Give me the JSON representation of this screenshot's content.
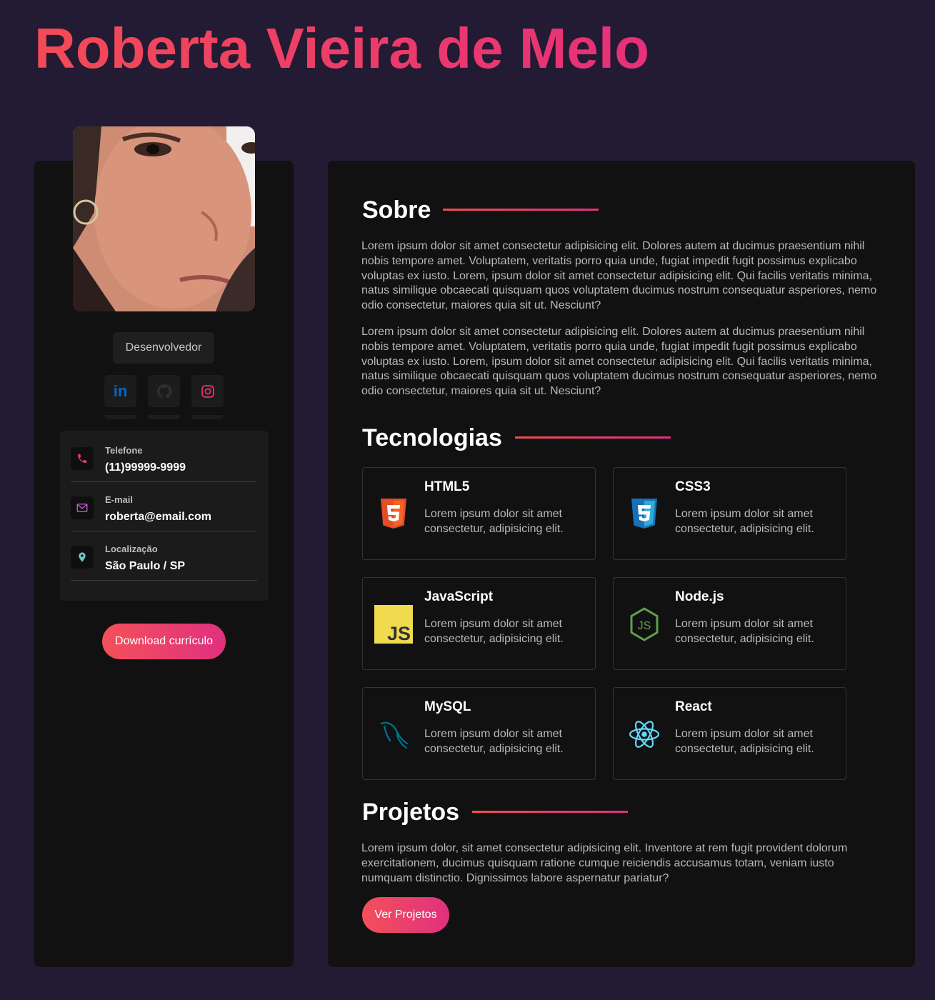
{
  "header": {
    "name": "Roberta Vieira de Melo"
  },
  "sidebar": {
    "role": "Desenvolvedor",
    "social": [
      {
        "icon": "linkedin-icon",
        "color": "#0a66c2"
      },
      {
        "icon": "github-icon",
        "color": "#2f2f2f"
      },
      {
        "icon": "instagram-icon",
        "color": "#e1306c"
      }
    ],
    "contacts": [
      {
        "label": "Telefone",
        "value": "(11)99999-9999",
        "icon": "phone-icon"
      },
      {
        "label": "E-mail",
        "value": "roberta@email.com",
        "icon": "mail-icon"
      },
      {
        "label": "Localização",
        "value": "São Paulo / SP",
        "icon": "location-icon"
      }
    ],
    "download_label": "Download currículo"
  },
  "about": {
    "title": "Sobre",
    "paragraphs": [
      "Lorem ipsum dolor sit amet consectetur adipisicing elit. Dolores autem at ducimus praesentium nihil nobis tempore amet. Voluptatem, veritatis porro quia unde, fugiat impedit fugit possimus explicabo voluptas ex iusto. Lorem, ipsum dolor sit amet consectetur adipisicing elit. Qui facilis veritatis minima, natus similique obcaecati quisquam quos voluptatem ducimus nostrum consequatur asperiores, nemo odio consectetur, maiores quia sit ut. Nesciunt?",
      "Lorem ipsum dolor sit amet consectetur adipisicing elit. Dolores autem at ducimus praesentium nihil nobis tempore amet. Voluptatem, veritatis porro quia unde, fugiat impedit fugit possimus explicabo voluptas ex iusto. Lorem, ipsum dolor sit amet consectetur adipisicing elit. Qui facilis veritatis minima, natus similique obcaecati quisquam quos voluptatem ducimus nostrum consequatur asperiores, nemo odio consectetur, maiores quia sit ut. Nesciunt?"
    ]
  },
  "technologies": {
    "title": "Tecnologias",
    "items": [
      {
        "name": "HTML5",
        "desc": "Lorem ipsum dolor sit amet consectetur, adipisicing elit.",
        "icon": "html5-icon",
        "color": "#e44d26"
      },
      {
        "name": "CSS3",
        "desc": "Lorem ipsum dolor sit amet consectetur, adipisicing elit.",
        "icon": "css3-icon",
        "color": "#1572b6"
      },
      {
        "name": "JavaScript",
        "desc": "Lorem ipsum dolor sit amet consectetur, adipisicing elit.",
        "icon": "javascript-icon",
        "color": "#f0db4f"
      },
      {
        "name": "Node.js",
        "desc": "Lorem ipsum dolor sit amet consectetur, adipisicing elit.",
        "icon": "nodejs-icon",
        "color": "#5fa04e"
      },
      {
        "name": "MySQL",
        "desc": "Lorem ipsum dolor sit amet consectetur, adipisicing elit.",
        "icon": "mysql-icon",
        "color": "#00758f"
      },
      {
        "name": "React",
        "desc": "Lorem ipsum dolor sit amet consectetur, adipisicing elit.",
        "icon": "react-icon",
        "color": "#61dafb"
      }
    ]
  },
  "projects": {
    "title": "Projetos",
    "text": "Lorem ipsum dolor, sit amet consectetur adipisicing elit. Inventore at rem fugit provident dolorum exercitationem, ducimus quisquam ratione cumque reiciendis accusamus totam, veniam iusto numquam distinctio. Dignissimos labore aspernatur pariatur?",
    "button_label": "Ver Projetos"
  },
  "colors": {
    "background": "#231a33",
    "panel": "#111111",
    "accent_start": "#f24b55",
    "accent_end": "#e0307f"
  }
}
